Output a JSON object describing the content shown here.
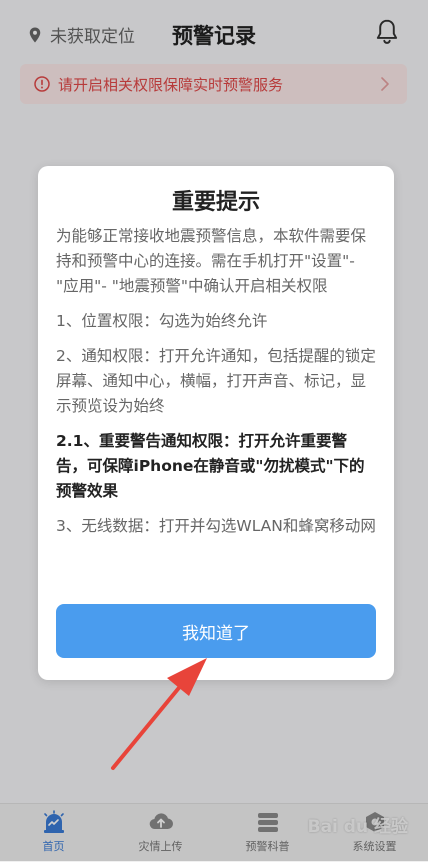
{
  "header": {
    "location_text": "未获取定位",
    "title": "预警记录"
  },
  "banner": {
    "text": "请开启相关权限保障实时预警服务"
  },
  "dialog": {
    "title": "重要提示",
    "paragraphs": [
      "为能够正常接收地震预警信息，本软件需要保持和预警中心的连接。需在手机打开\"设置\"-\"应用\"- \"地震预警\"中确认开启相关权限",
      "1、位置权限：勾选为始终允许",
      "2、通知权限：打开允许通知，包括提醒的锁定屏幕、通知中心，横幅，打开声音、标记，显示预览设为始终",
      "2.1、重要警告通知权限：打开允许重要警告，可保障iPhone在静音或\"勿扰模式\"下的预警效果",
      "3、无线数据：打开并勾选WLAN和蜂窝移动网"
    ],
    "confirm_label": "我知道了"
  },
  "nav": {
    "items": [
      {
        "label": "首页",
        "icon": "alarm-icon",
        "active": true
      },
      {
        "label": "灾情上传",
        "icon": "cloud-upload-icon",
        "active": false
      },
      {
        "label": "预警科普",
        "icon": "layers-icon",
        "active": false
      },
      {
        "label": "系统设置",
        "icon": "settings-icon",
        "active": false
      }
    ]
  },
  "watermark": "Bai du 经验",
  "colors": {
    "accent": "#4a9cee",
    "warning": "#e04848",
    "nav_active": "#3a7bd5",
    "annotation_arrow": "#e8443a"
  }
}
